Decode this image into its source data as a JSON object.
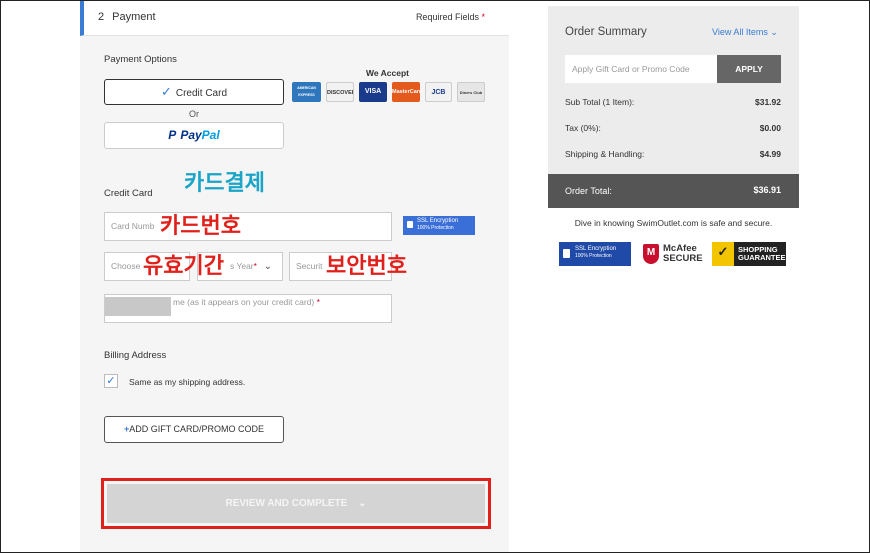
{
  "step": {
    "number": "2",
    "title": "Payment",
    "required": "Required Fields",
    "required_star": "*"
  },
  "payment_options": {
    "label": "Payment Options",
    "credit_card_label": "Credit Card",
    "check_icon": "checkmark-icon",
    "or_text": "Or",
    "paypal_p": "Pay",
    "paypal_pal": "Pal",
    "we_accept": "We Accept",
    "cards": [
      {
        "name": "AMERICAN EXPRESS",
        "color": "#2e77bc"
      },
      {
        "name": "DISCOVER",
        "color": "#f2f2f2"
      },
      {
        "name": "VISA",
        "color": "#1a3a8c"
      },
      {
        "name": "MasterCard",
        "color": "#e35a1c"
      },
      {
        "name": "JCB",
        "color": "#f2f2f2"
      },
      {
        "name": "Diners Club",
        "color": "#e6e6e6"
      }
    ]
  },
  "credit_card": {
    "section_label": "Credit Card",
    "card_number_placeholder": "Card Numb",
    "ssl_title": "SSL Encryption",
    "ssl_sub": "100% Protection",
    "month_placeholder": "Choose",
    "year_placeholder": "s Year",
    "star": "*",
    "security_placeholder": "Securit",
    "name_placeholder": "me (as it appears on your credit card)",
    "chevron_icon": "chevron-down-icon"
  },
  "annotations": {
    "card_payment": "카드결제",
    "card_number": "카드번호",
    "expiry": "유효기간",
    "security_code": "보안번호"
  },
  "billing": {
    "label": "Billing Address",
    "same_as_shipping": "Same as my shipping address.",
    "checked": true
  },
  "gift_button": "ADD GIFT CARD/PROMO CODE",
  "review_button": "REVIEW AND COMPLETE",
  "order_summary": {
    "title": "Order Summary",
    "view_all": "View All Items",
    "promo_placeholder": "Apply Gift Card or Promo Code",
    "apply": "APPLY",
    "rows": [
      {
        "label": "Sub Total (1 Item):",
        "value": "$31.92"
      },
      {
        "label": "Tax (0%):",
        "value": "$0.00"
      },
      {
        "label": "Shipping & Handling:",
        "value": "$4.99"
      }
    ],
    "total_label": "Order Total:",
    "total_value": "$36.91",
    "safe_text": "Dive in knowing SwimOutlet.com is safe and secure.",
    "badge_ssl_title": "SSL Encryption",
    "badge_ssl_sub": "100% Protection",
    "mcafee_line1": "McAfee",
    "mcafee_line2": "SECURE",
    "sg_line1": "SHOPPING",
    "sg_line2": "GUARANTEE"
  }
}
